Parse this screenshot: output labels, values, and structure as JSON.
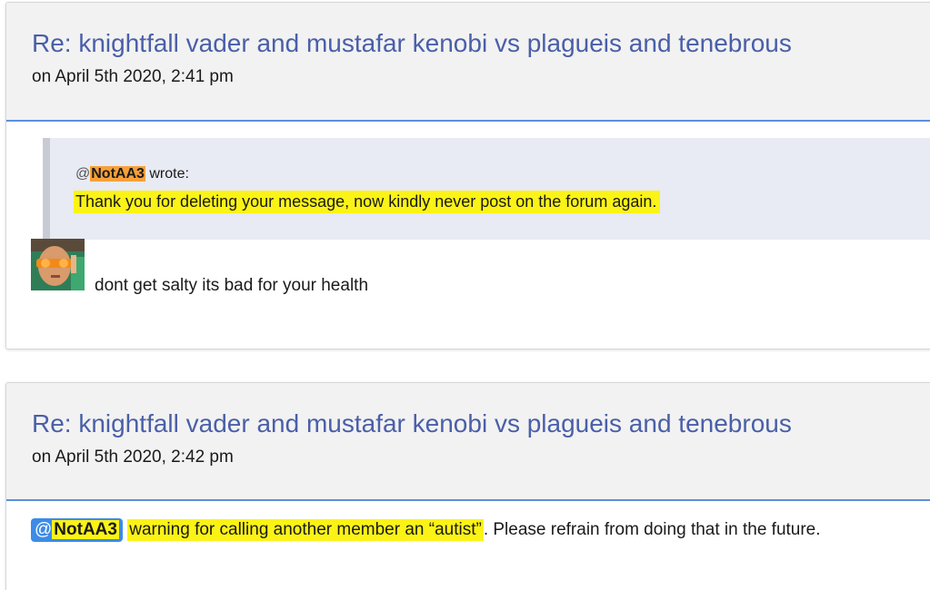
{
  "posts": [
    {
      "title": "Re: knightfall vader and mustafar kenobi vs plagueis and tenebrous",
      "date": "on April 5th 2020, 2:41 pm",
      "quote": {
        "at_sign": "@",
        "author": "NotAA3",
        "wrote_label": " wrote:",
        "text": "Thank you for deleting your message, now kindly never post on the forum again."
      },
      "reply": "dont get salty its bad for your health"
    },
    {
      "title": "Re: knightfall vader and mustafar kenobi vs plagueis and tenebrous",
      "date": "on April 5th 2020, 2:42 pm",
      "mention_at": "@",
      "mention_name": "NotAA3",
      "warning_highlight": "warning for calling another member an “autist”",
      "warning_rest": ". Please refrain from doing that in the future."
    }
  ],
  "colors": {
    "title": "#4a5fa8",
    "header_border": "#5b8fde",
    "highlight_yellow": "#fbf316",
    "highlight_orange": "#f7a03a",
    "mention_blue": "#3d8be8",
    "quote_bg": "#e8eaf4"
  }
}
